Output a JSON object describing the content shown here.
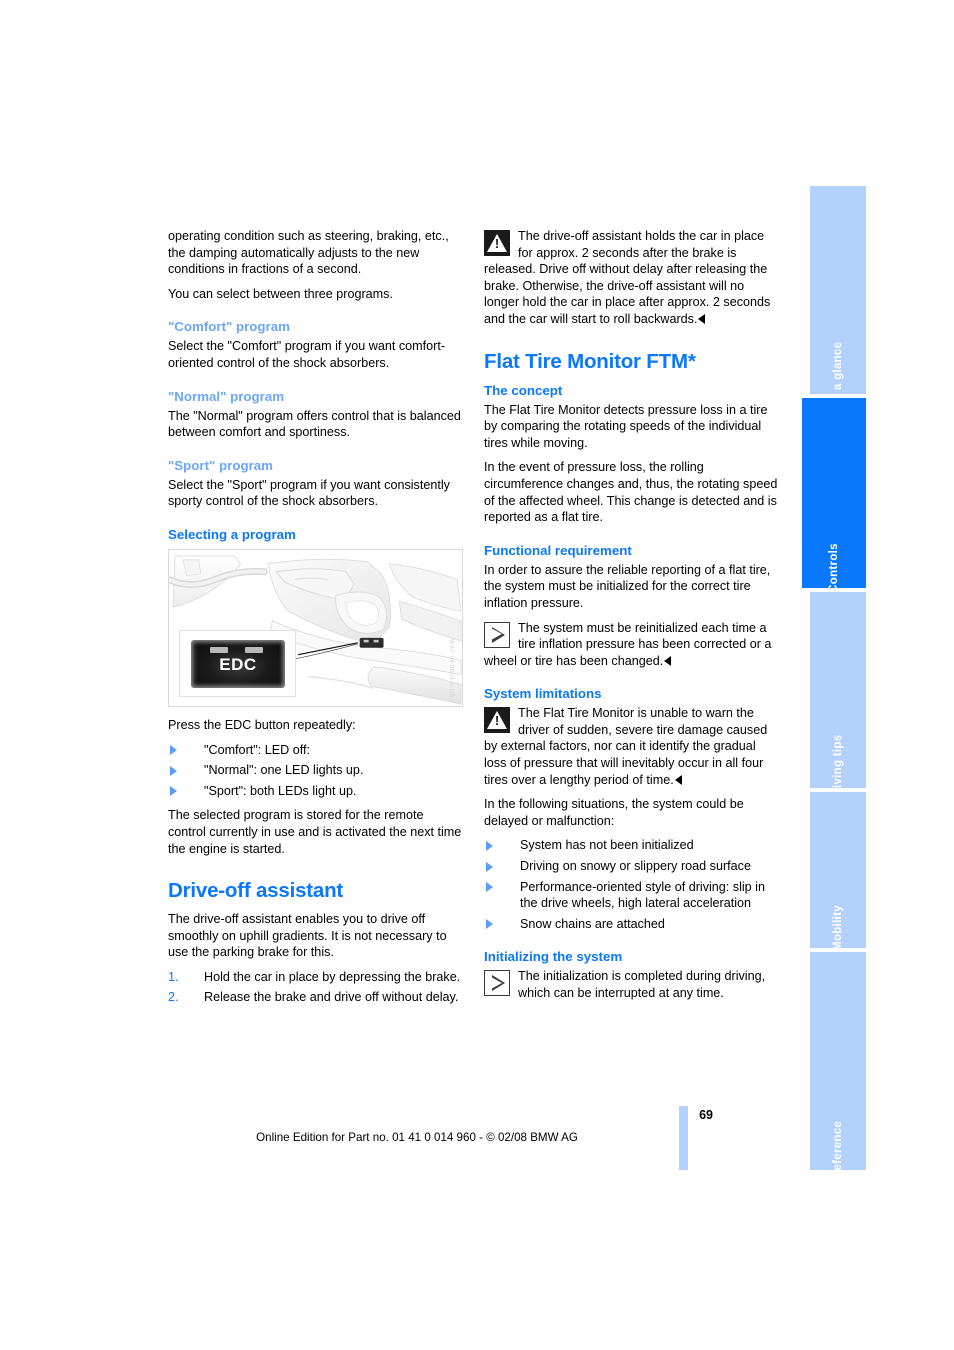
{
  "document": {
    "page_number": "69",
    "edition_line": "Online Edition for Part no. 01 41 0 014 960 - © 02/08 BMW AG"
  },
  "colors": {
    "accent": "#0a78fc",
    "accent_light": "#6ba6f7",
    "tab_inactive": "#b3d1fc",
    "tab_active": "#0a78fc"
  },
  "tabs": [
    {
      "label": "At a glance",
      "active": false
    },
    {
      "label": "Controls",
      "active": true
    },
    {
      "label": "Driving tips",
      "active": false
    },
    {
      "label": "Mobility",
      "active": false
    },
    {
      "label": "Reference",
      "active": false
    }
  ],
  "left_column": {
    "intro_paragraph": "operating condition such as steering, braking, etc., the damping automatically adjusts to the new conditions in fractions of a second.",
    "intro_paragraph_2": "You can select between three programs.",
    "comfort": {
      "heading": "\"Comfort\" program",
      "text": "Select the \"Comfort\" program if you want comfort-oriented control of the shock absorbers."
    },
    "normal": {
      "heading": "\"Normal\" program",
      "text": "The \"Normal\" program offers control that is balanced between comfort and sportiness."
    },
    "sport": {
      "heading": "\"Sport\" program",
      "text": "Select the \"Sport\" program if you want consistently sporty control of the shock absorbers."
    },
    "selecting": {
      "heading": "Selecting a program",
      "figure": {
        "alt": "Car interior center console with EDC button, inset close-up",
        "button_label": "EDC",
        "credit": "WAP 08 0003 A-US"
      },
      "lead": "Press the EDC button repeatedly:",
      "items": [
        "\"Comfort\": LED off:",
        "\"Normal\": one LED lights up.",
        "\"Sport\": both LEDs light up."
      ],
      "closing": "The selected program is stored for the remote control currently in use and is activated the next time the engine is started."
    },
    "drive_off": {
      "heading": "Drive-off assistant",
      "intro": "The drive-off assistant enables you to drive off smoothly on uphill gradients. It is not necessary to use the parking brake for this.",
      "steps": [
        {
          "num": "1.",
          "text": "Hold the car in place by depressing the brake."
        },
        {
          "num": "2.",
          "text": "Release the brake and drive off without delay."
        }
      ]
    }
  },
  "right_column": {
    "warning_drive_off": {
      "icon": "warning-icon",
      "text": "The drive-off assistant holds the car in place for approx. 2 seconds after the brake is released. Drive off without delay after releasing the brake. Otherwise, the drive-off assistant will no longer hold the car in place after approx. 2 seconds and the car will start to roll backwards."
    },
    "ftm": {
      "heading": "Flat Tire Monitor FTM*",
      "concept": {
        "heading": "The concept",
        "paragraph_1": "The Flat Tire Monitor detects pressure loss in a tire by comparing the rotating speeds of the individual tires while moving.",
        "paragraph_2": "In the event of pressure loss, the rolling circumference changes and, thus, the rotating speed of the affected wheel. This change is detected and is reported as a flat tire."
      },
      "functional_requirement": {
        "heading": "Functional requirement",
        "paragraph": "In order to assure the reliable reporting of a flat tire, the system must be initialized for the correct tire inflation pressure.",
        "note": {
          "icon": "note-icon",
          "text": "The system must be reinitialized each time a tire inflation pressure has been corrected or a wheel or tire has been changed."
        }
      },
      "system_limitations": {
        "heading": "System limitations",
        "warning": {
          "icon": "warning-icon",
          "text": "The Flat Tire Monitor is unable to warn the driver of sudden, severe tire damage caused by external factors, nor can it identify the gradual loss of pressure that will inevitably occur in all four tires over a lengthy period of time."
        },
        "lead": "In the following situations, the system could be delayed or malfunction:",
        "items": [
          "System has not been initialized",
          "Driving on snowy or slippery road surface",
          "Performance-oriented style of driving: slip in the drive wheels, high lateral acceleration",
          "Snow chains are attached"
        ]
      },
      "initializing": {
        "heading": "Initializing the system",
        "note": {
          "icon": "note-icon",
          "text": "The initialization is completed during driving, which can be interrupted at any time."
        }
      }
    }
  }
}
